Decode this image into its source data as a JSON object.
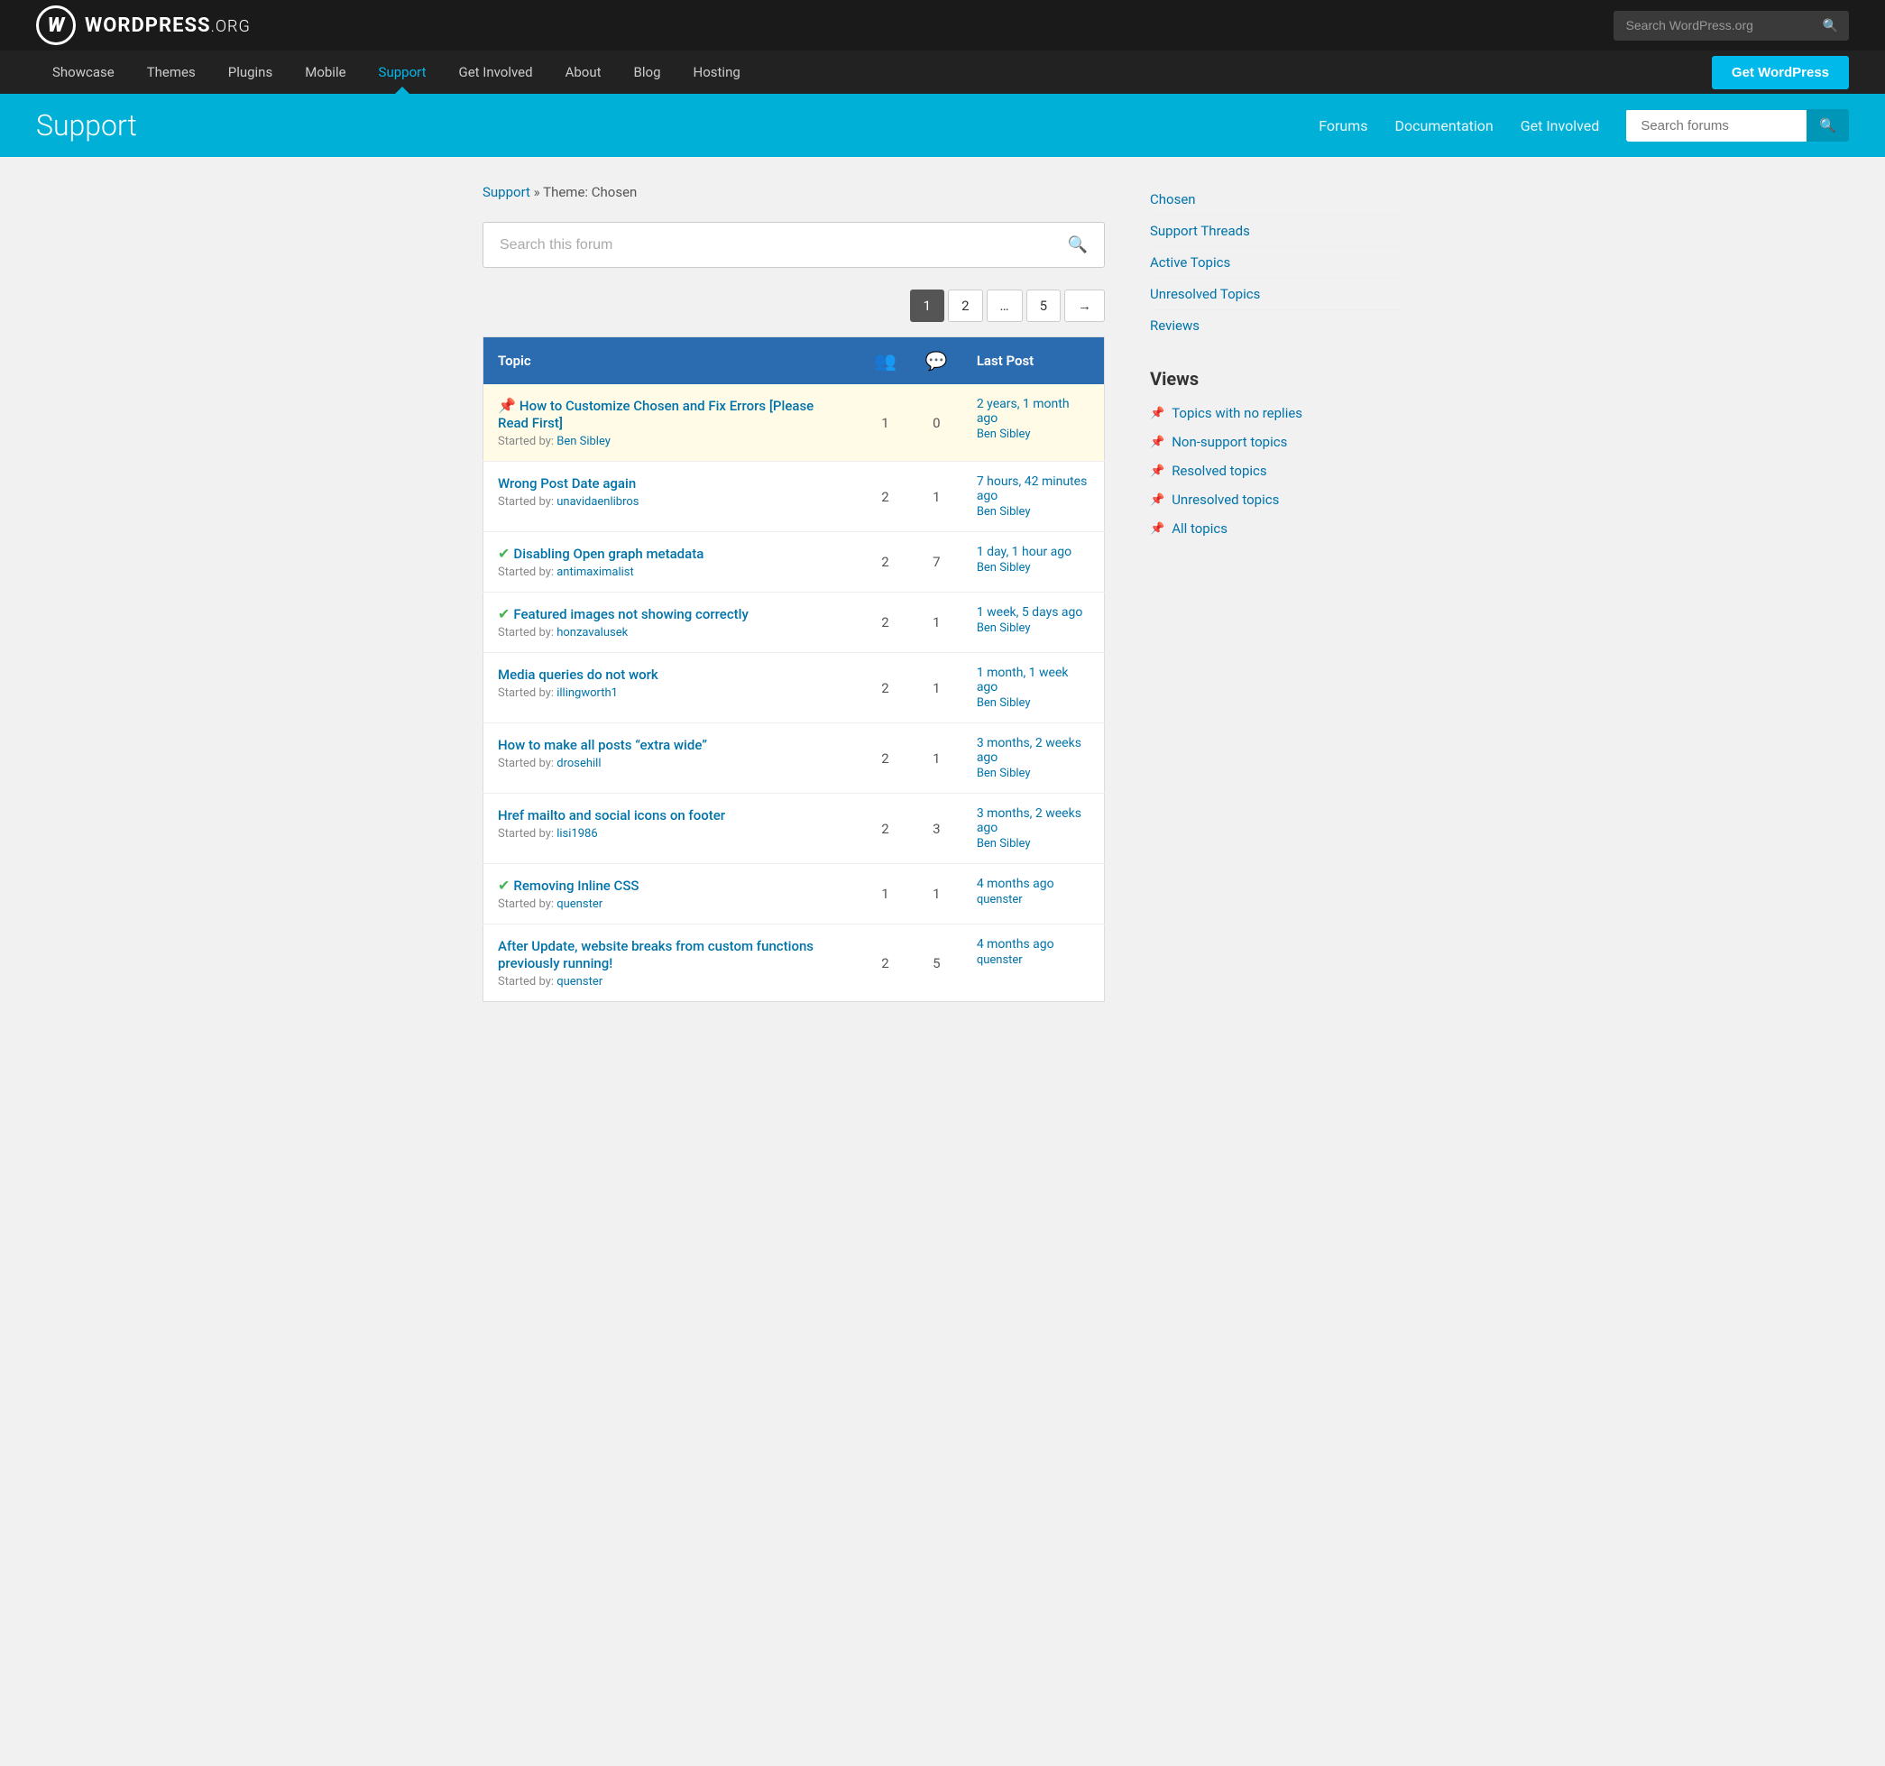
{
  "topNav": {
    "logo": {
      "letter": "W",
      "text": "WORDPRESS",
      "suffix": ".ORG"
    },
    "searchPlaceholder": "Search WordPress.org",
    "links": [
      {
        "label": "Showcase",
        "href": "#",
        "active": false
      },
      {
        "label": "Themes",
        "href": "#",
        "active": false
      },
      {
        "label": "Plugins",
        "href": "#",
        "active": false
      },
      {
        "label": "Mobile",
        "href": "#",
        "active": false
      },
      {
        "label": "Support",
        "href": "#",
        "active": true
      },
      {
        "label": "Get Involved",
        "href": "#",
        "active": false
      },
      {
        "label": "About",
        "href": "#",
        "active": false
      },
      {
        "label": "Blog",
        "href": "#",
        "active": false
      },
      {
        "label": "Hosting",
        "href": "#",
        "active": false
      }
    ],
    "getWordPressLabel": "Get WordPress"
  },
  "supportHeader": {
    "title": "Support",
    "navLinks": [
      {
        "label": "Forums",
        "href": "#"
      },
      {
        "label": "Documentation",
        "href": "#"
      },
      {
        "label": "Get Involved",
        "href": "#"
      }
    ],
    "searchPlaceholder": "Search forums"
  },
  "breadcrumb": {
    "links": [
      {
        "label": "Support",
        "href": "#"
      }
    ],
    "current": "Theme: Chosen"
  },
  "forumSearch": {
    "placeholder": "Search this forum"
  },
  "pagination": {
    "pages": [
      "1",
      "2",
      "…",
      "5"
    ],
    "activePage": "1",
    "nextLabel": "→"
  },
  "tableHeaders": {
    "topic": "Topic",
    "lastPost": "Last Post"
  },
  "topics": [
    {
      "pinned": true,
      "resolved": false,
      "icon": "pin",
      "title": "How to Customize Chosen and Fix Errors [Please Read First]",
      "startedBy": "Ben Sibley",
      "voices": 1,
      "replies": 0,
      "lastPostTime": "2 years, 1 month ago",
      "lastPostUser": "Ben Sibley"
    },
    {
      "pinned": false,
      "resolved": false,
      "icon": "none",
      "title": "Wrong Post Date again",
      "startedBy": "unavidaenlibros",
      "voices": 2,
      "replies": 1,
      "lastPostTime": "7 hours, 42 minutes ago",
      "lastPostUser": "Ben Sibley"
    },
    {
      "pinned": false,
      "resolved": true,
      "icon": "check",
      "title": "Disabling Open graph metadata",
      "startedBy": "antimaximalist",
      "voices": 2,
      "replies": 7,
      "lastPostTime": "1 day, 1 hour ago",
      "lastPostUser": "Ben Sibley"
    },
    {
      "pinned": false,
      "resolved": true,
      "icon": "check",
      "title": "Featured images not showing correctly",
      "startedBy": "honzavalusek",
      "voices": 2,
      "replies": 1,
      "lastPostTime": "1 week, 5 days ago",
      "lastPostUser": "Ben Sibley"
    },
    {
      "pinned": false,
      "resolved": false,
      "icon": "none",
      "title": "Media queries do not work",
      "startedBy": "illingworth1",
      "voices": 2,
      "replies": 1,
      "lastPostTime": "1 month, 1 week ago",
      "lastPostUser": "Ben Sibley"
    },
    {
      "pinned": false,
      "resolved": false,
      "icon": "none",
      "title": "How to make all posts “extra wide”",
      "startedBy": "drosehill",
      "voices": 2,
      "replies": 1,
      "lastPostTime": "3 months, 2 weeks ago",
      "lastPostUser": "Ben Sibley"
    },
    {
      "pinned": false,
      "resolved": false,
      "icon": "none",
      "title": "Href mailto and social icons on footer",
      "startedBy": "lisi1986",
      "voices": 2,
      "replies": 3,
      "lastPostTime": "3 months, 2 weeks ago",
      "lastPostUser": "Ben Sibley"
    },
    {
      "pinned": false,
      "resolved": true,
      "icon": "check",
      "title": "Removing Inline CSS",
      "startedBy": "quenster",
      "voices": 1,
      "replies": 1,
      "lastPostTime": "4 months ago",
      "lastPostUser": "quenster"
    },
    {
      "pinned": false,
      "resolved": false,
      "icon": "none",
      "title": "After Update, website breaks from custom functions previously running!",
      "startedBy": "quenster",
      "voices": 2,
      "replies": 5,
      "lastPostTime": "4 months ago",
      "lastPostUser": "quenster"
    }
  ],
  "sidebar": {
    "topLinks": [
      {
        "label": "Chosen"
      },
      {
        "label": "Support Threads"
      },
      {
        "label": "Active Topics"
      },
      {
        "label": "Unresolved Topics"
      },
      {
        "label": "Reviews"
      }
    ],
    "viewsHeading": "Views",
    "viewsLinks": [
      {
        "label": "Topics with no replies"
      },
      {
        "label": "Non-support topics"
      },
      {
        "label": "Resolved topics"
      },
      {
        "label": "Unresolved topics"
      },
      {
        "label": "All topics"
      }
    ]
  }
}
